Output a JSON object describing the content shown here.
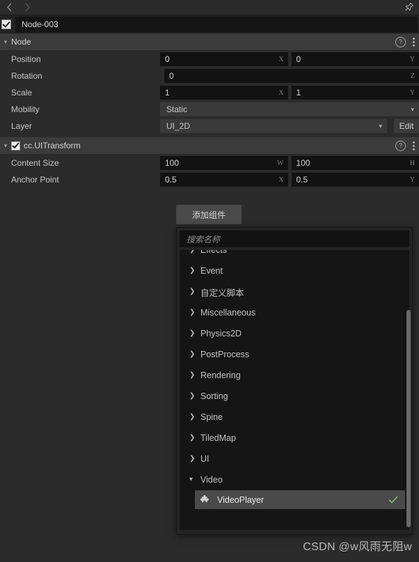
{
  "topbar": {
    "back_icon": "chevron-left-icon",
    "forward_icon": "chevron-right-icon",
    "pin_icon": "pin-icon"
  },
  "node": {
    "enabled": true,
    "name": "Node-003"
  },
  "sections": [
    {
      "id": "node",
      "title": "Node",
      "has_checkbox": false,
      "expanded": true,
      "help_icon": "help-circle-icon",
      "menu_icon": "kebab-menu-icon",
      "rows": [
        {
          "label": "Position",
          "type": "vector",
          "fields": [
            {
              "value": "0",
              "axis": "X"
            },
            {
              "value": "0",
              "axis": "Y"
            }
          ]
        },
        {
          "label": "Rotation",
          "type": "single",
          "fields": [
            {
              "value": "0",
              "axis": "Z"
            }
          ]
        },
        {
          "label": "Scale",
          "type": "vector",
          "fields": [
            {
              "value": "1",
              "axis": "X"
            },
            {
              "value": "1",
              "axis": "Y"
            }
          ]
        },
        {
          "label": "Mobility",
          "type": "select",
          "value": "Static",
          "chevron": "chevron-down-icon"
        },
        {
          "label": "Layer",
          "type": "select-edit",
          "value": "UI_2D",
          "chevron": "chevron-down-icon",
          "button_label": "Edit"
        }
      ]
    },
    {
      "id": "uitransform",
      "title": "cc.UITransform",
      "has_checkbox": true,
      "checked": true,
      "expanded": true,
      "help_icon": "help-circle-icon",
      "menu_icon": "kebab-menu-icon",
      "rows": [
        {
          "label": "Content Size",
          "type": "vector",
          "fields": [
            {
              "value": "100",
              "axis": "W"
            },
            {
              "value": "100",
              "axis": "H"
            }
          ]
        },
        {
          "label": "Anchor Point",
          "type": "vector",
          "fields": [
            {
              "value": "0.5",
              "axis": "X"
            },
            {
              "value": "0.5",
              "axis": "Y"
            }
          ]
        }
      ]
    }
  ],
  "add_component": {
    "button_label": "添加组件"
  },
  "component_picker": {
    "search_placeholder": "搜索名称",
    "categories": [
      {
        "label": "Effects",
        "expanded": false,
        "arrow": "chevron-right-icon"
      },
      {
        "label": "Event",
        "expanded": false,
        "arrow": "chevron-right-icon"
      },
      {
        "label": "自定义脚本",
        "expanded": false,
        "arrow": "chevron-right-icon"
      },
      {
        "label": "Miscellaneous",
        "expanded": false,
        "arrow": "chevron-right-icon"
      },
      {
        "label": "Physics2D",
        "expanded": false,
        "arrow": "chevron-right-icon"
      },
      {
        "label": "PostProcess",
        "expanded": false,
        "arrow": "chevron-right-icon"
      },
      {
        "label": "Rendering",
        "expanded": false,
        "arrow": "chevron-right-icon"
      },
      {
        "label": "Sorting",
        "expanded": false,
        "arrow": "chevron-right-icon"
      },
      {
        "label": "Spine",
        "expanded": false,
        "arrow": "chevron-right-icon"
      },
      {
        "label": "TiledMap",
        "expanded": false,
        "arrow": "chevron-right-icon"
      },
      {
        "label": "UI",
        "expanded": false,
        "arrow": "chevron-right-icon"
      },
      {
        "label": "Video",
        "expanded": true,
        "arrow": "chevron-down-icon"
      }
    ],
    "selected_item": {
      "label": "VideoPlayer",
      "icon": "puzzle-piece-icon",
      "check_icon": "check-icon",
      "selected": true
    }
  },
  "watermark": {
    "text": "CSDN @w风雨无阻w"
  },
  "colors": {
    "panel_bg": "#2b2b2b",
    "field_bg": "#121212",
    "header_bg": "#3b3b3b",
    "list_bg": "#151515",
    "highlight": "#4a4a4a",
    "check_green": "#9fc08a"
  }
}
